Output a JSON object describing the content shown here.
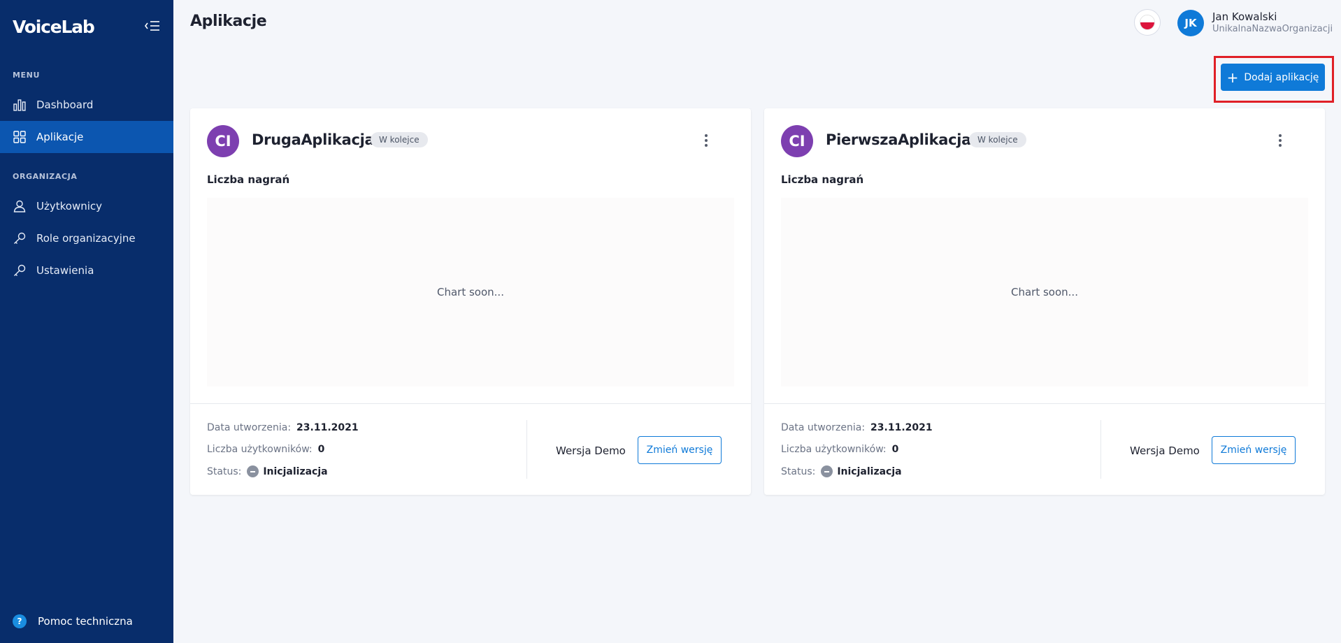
{
  "sidebar": {
    "logo": "VoiceLab",
    "menu_label": "MENU",
    "menu_items": [
      {
        "label": "Dashboard",
        "icon": "bar-chart-icon"
      },
      {
        "label": "Aplikacje",
        "icon": "grid-icon",
        "active": true
      }
    ],
    "org_label": "ORGANIZACJA",
    "org_items": [
      {
        "label": "Użytkownicy",
        "icon": "user-icon"
      },
      {
        "label": "Role organizacyjne",
        "icon": "key-icon"
      },
      {
        "label": "Ustawienia",
        "icon": "key-icon"
      }
    ],
    "help": {
      "label": "Pomoc techniczna",
      "icon_text": "?"
    }
  },
  "header": {
    "title": "Aplikacje",
    "language": "pl",
    "user": {
      "initials": "JK",
      "name": "Jan Kowalski",
      "org": "UnikalnaNazwaOrganizacji"
    }
  },
  "actions": {
    "add_app_label": "Dodaj aplikację"
  },
  "apps": [
    {
      "initials": "CI",
      "name": "DrugaAplikacja",
      "badge": "W kolejce",
      "chart_title": "Liczba nagrań",
      "chart_placeholder": "Chart soon...",
      "created_label": "Data utworzenia:",
      "created_value": "23.11.2021",
      "users_label": "Liczba użytkowników:",
      "users_value": "0",
      "status_label": "Status:",
      "status_value": "Inicjalizacja",
      "version": "Wersja Demo",
      "change_version_label": "Zmień wersję"
    },
    {
      "initials": "CI",
      "name": "PierwszaAplikacja",
      "badge": "W kolejce",
      "chart_title": "Liczba nagrań",
      "chart_placeholder": "Chart soon...",
      "created_label": "Data utworzenia:",
      "created_value": "23.11.2021",
      "users_label": "Liczba użytkowników:",
      "users_value": "0",
      "status_label": "Status:",
      "status_value": "Inicjalizacja",
      "version": "Wersja Demo",
      "change_version_label": "Zmień wersję"
    }
  ],
  "colors": {
    "sidebar_bg": "#082d6b",
    "sidebar_active": "#0c56b0",
    "accent": "#0f7ad8",
    "app_avatar": "#7d3fb0",
    "highlight": "#e02027"
  }
}
